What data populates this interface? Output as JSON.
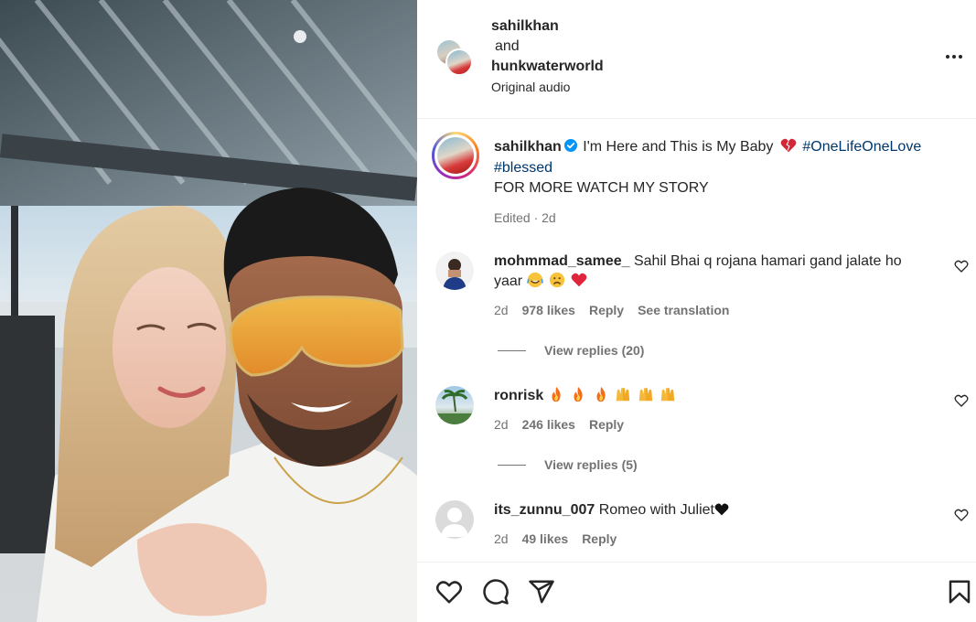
{
  "post": {
    "header": {
      "author": "sahilkhan",
      "connector": "and",
      "collaborator": "hunkwaterworld",
      "audio": "Original audio",
      "more_icon": "more-horizontal-icon"
    },
    "caption": {
      "username": "sahilkhan",
      "verified": true,
      "text": "I'm Here and This is My Baby",
      "emoji": "heart-red",
      "hashtags": [
        "#OneLifeOneLove",
        "#blessed"
      ],
      "line2": "FOR MORE WATCH MY STORY",
      "meta": "Edited · 2d"
    },
    "comments": [
      {
        "username": "mohmmad_samee_",
        "text": "Sahil Bhai q rojana hamari gand jalate ho yaar",
        "emojis": [
          "face-tears-of-joy",
          "sad-face",
          "red-heart"
        ],
        "time": "2d",
        "likes": "978 likes",
        "reply": "Reply",
        "translate": "See translation",
        "view_replies": "View replies (20)"
      },
      {
        "username": "ronrisk",
        "text": "",
        "emojis": [
          "fire",
          "fire",
          "fire",
          "raising-hands",
          "raising-hands",
          "raising-hands"
        ],
        "time": "2d",
        "likes": "246 likes",
        "reply": "Reply",
        "view_replies": "View replies (5)"
      },
      {
        "username": "its_zunnu_007",
        "text": "Romeo with Juliet",
        "emojis": [
          "black-heart"
        ],
        "time": "2d",
        "likes": "49 likes",
        "reply": "Reply"
      }
    ],
    "actions": [
      "like-icon",
      "comment-icon",
      "share-icon",
      "save-icon"
    ],
    "colors": {
      "text": "#262626",
      "secondary": "#737373",
      "hashtag": "#00376b",
      "verified": "#0095f6",
      "divider": "#efefef"
    }
  }
}
